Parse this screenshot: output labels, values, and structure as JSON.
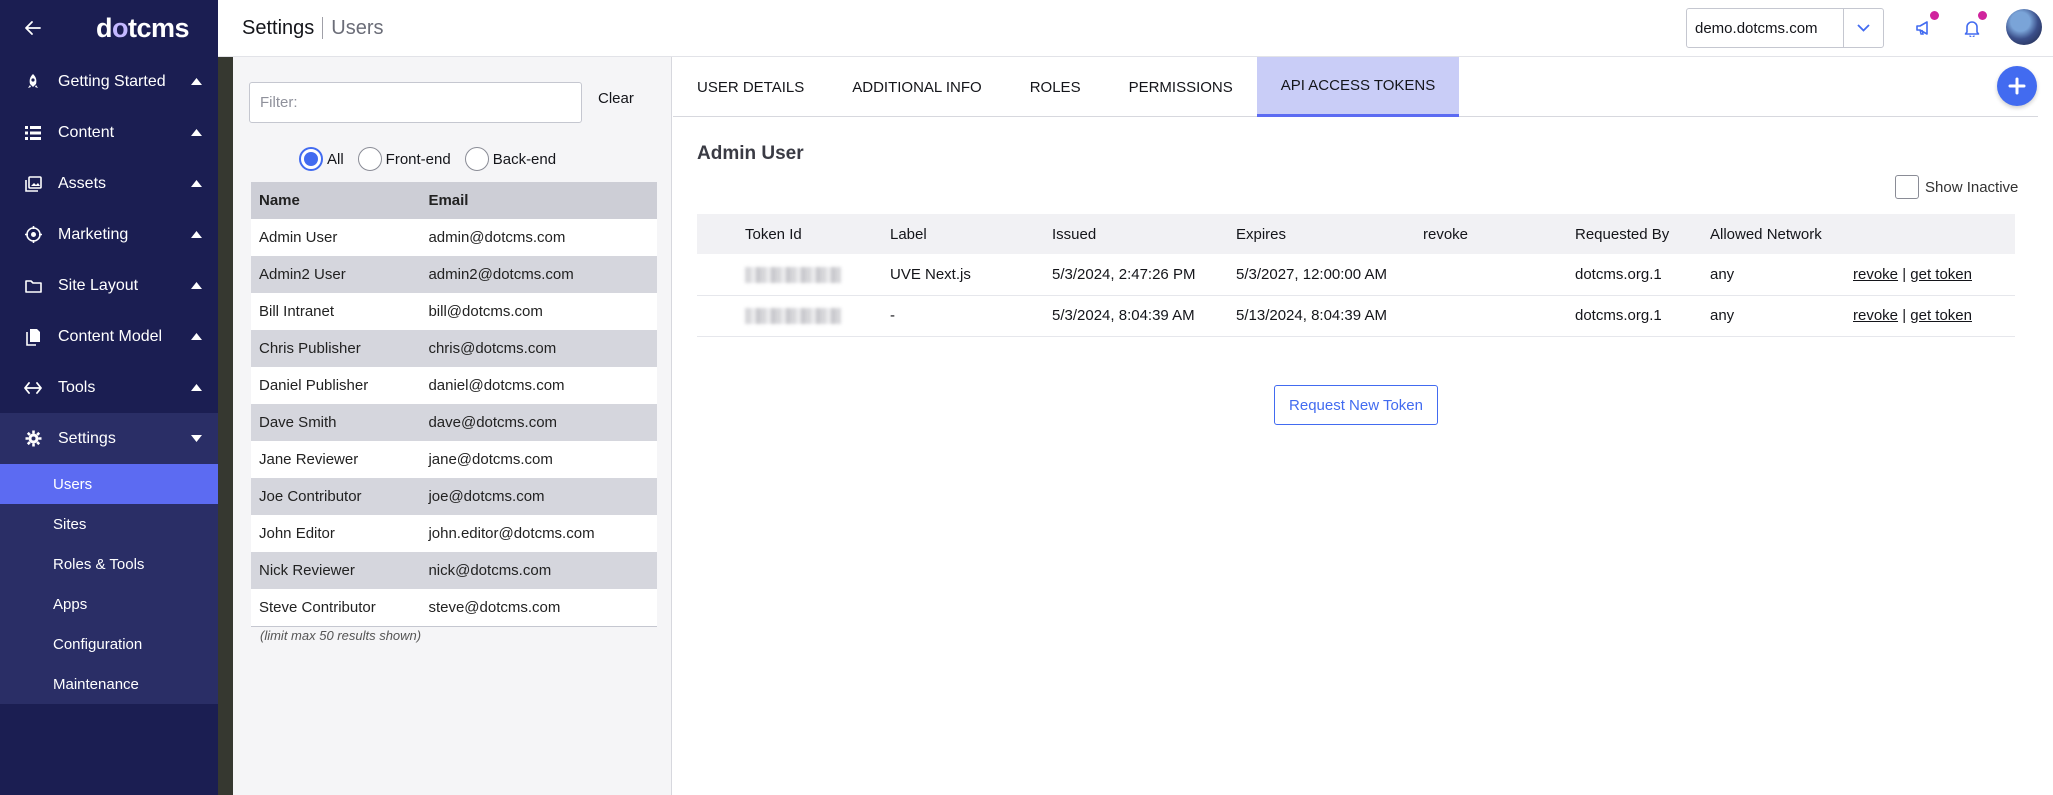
{
  "brand": {
    "logo_prefix": "d",
    "logo_accent": "o",
    "logo_suffix": "tcms"
  },
  "sidebar": {
    "groups": [
      {
        "label": "Getting Started",
        "icon": "rocket-icon"
      },
      {
        "label": "Content",
        "icon": "list-icon"
      },
      {
        "label": "Assets",
        "icon": "images-icon"
      },
      {
        "label": "Marketing",
        "icon": "target-icon"
      },
      {
        "label": "Site Layout",
        "icon": "folder-icon"
      },
      {
        "label": "Content Model",
        "icon": "copy-icon"
      },
      {
        "label": "Tools",
        "icon": "code-arrows-icon"
      },
      {
        "label": "Settings",
        "icon": "gear-icon"
      }
    ],
    "settings_items": [
      "Users",
      "Sites",
      "Roles & Tools",
      "Apps",
      "Configuration",
      "Maintenance"
    ]
  },
  "header": {
    "breadcrumb": [
      "Settings",
      "Users"
    ],
    "site": "demo.dotcms.com"
  },
  "users_panel": {
    "filter_placeholder": "Filter:",
    "clear_label": "Clear",
    "radios": [
      "All",
      "Front-end",
      "Back-end"
    ],
    "columns": [
      "Name",
      "Email"
    ],
    "users": [
      [
        "Admin User",
        "admin@dotcms.com"
      ],
      [
        "Admin2 User",
        "admin2@dotcms.com"
      ],
      [
        "Bill Intranet",
        "bill@dotcms.com"
      ],
      [
        "Chris Publisher",
        "chris@dotcms.com"
      ],
      [
        "Daniel Publisher",
        "daniel@dotcms.com"
      ],
      [
        "Dave Smith",
        "dave@dotcms.com"
      ],
      [
        "Jane Reviewer",
        "jane@dotcms.com"
      ],
      [
        "Joe Contributor",
        "joe@dotcms.com"
      ],
      [
        "John Editor",
        "john.editor@dotcms.com"
      ],
      [
        "Nick Reviewer",
        "nick@dotcms.com"
      ],
      [
        "Steve Contributor",
        "steve@dotcms.com"
      ]
    ],
    "limit_note": "(limit max 50 results shown)"
  },
  "tabs": [
    "USER DETAILS",
    "ADDITIONAL INFO",
    "ROLES",
    "PERMISSIONS",
    "API ACCESS TOKENS"
  ],
  "main": {
    "user_title": "Admin User",
    "show_inactive": "Show Inactive",
    "token_columns": [
      "Token Id",
      "Label",
      "Issued",
      "Expires",
      "revoke",
      "Requested By",
      "Allowed Network"
    ],
    "tokens": [
      {
        "label": "UVE Next.js",
        "issued": "5/3/2024, 2:47:26 PM",
        "expires": "5/3/2027, 12:00:00 AM",
        "requested_by": "dotcms.org.1",
        "network": "any"
      },
      {
        "label": "-",
        "issued": "5/3/2024, 8:04:39 AM",
        "expires": "5/13/2024, 8:04:39 AM",
        "requested_by": "dotcms.org.1",
        "network": "any"
      }
    ],
    "revoke_label": "revoke",
    "separator": "|",
    "get_token_label": "get token",
    "request_button": "Request New Token"
  },
  "colors": {
    "sidebar_bg": "#1b1e52",
    "sidebar_active": "#5c6bf2",
    "accent": "#426bf0",
    "notification_dot": "#d0249d"
  }
}
